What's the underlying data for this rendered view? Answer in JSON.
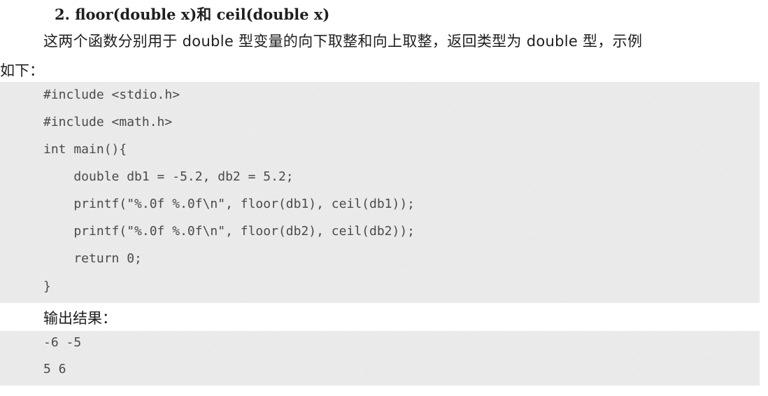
{
  "heading": "2.  floor(double x)和 ceil(double x)",
  "paragraph_line1": "这两个函数分别用于 double 型变量的向下取整和向上取整，返回类型为 double 型，示例",
  "paragraph_line2": "如下：",
  "code_lines": [
    "#include <stdio.h>",
    "#include <math.h>",
    "int main(){",
    "    double db1 = -5.2, db2 = 5.2;",
    "    printf(\"%.0f %.0f\\n\", floor(db1), ceil(db1));",
    "    printf(\"%.0f %.0f\\n\", floor(db2), ceil(db2));",
    "    return 0;",
    "}"
  ],
  "output_label": "输出结果：",
  "output_lines": [
    "-6 -5",
    "5 6"
  ]
}
